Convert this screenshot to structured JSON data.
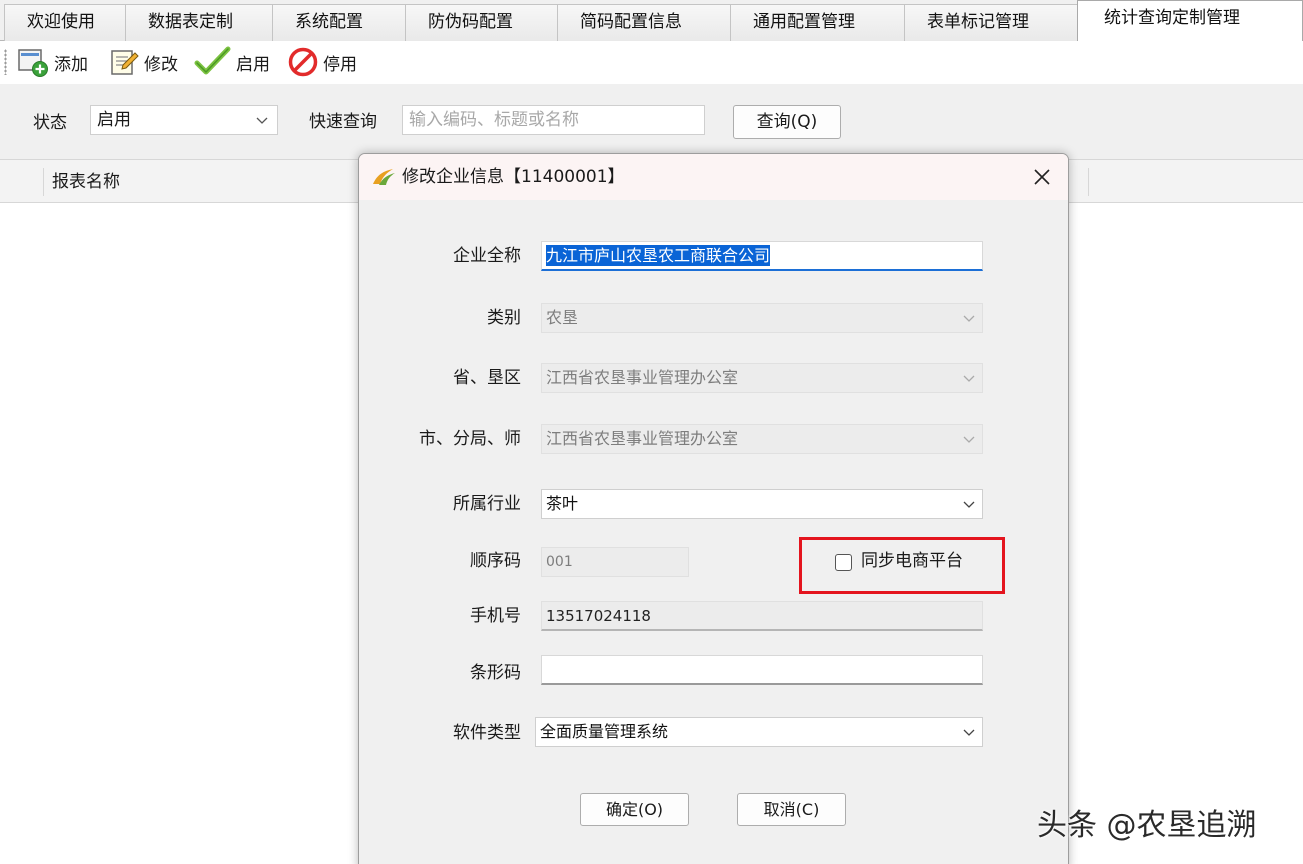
{
  "tabs": [
    {
      "label": "欢迎使用"
    },
    {
      "label": "数据表定制"
    },
    {
      "label": "系统配置"
    },
    {
      "label": "防伪码配置"
    },
    {
      "label": "简码配置信息"
    },
    {
      "label": "通用配置管理"
    },
    {
      "label": "表单标记管理"
    },
    {
      "label": "统计查询定制管理"
    }
  ],
  "toolbar": {
    "add_label": "添加",
    "edit_label": "修改",
    "enable_label": "启用",
    "disable_label": "停用"
  },
  "filter": {
    "status_label": "状态",
    "status_value": "启用",
    "quick_label": "快速查询",
    "quick_placeholder": "输入编码、标题或名称",
    "query_button": "查询(Q)"
  },
  "grid": {
    "columns": [
      "报表名称"
    ]
  },
  "dialog": {
    "title": "修改企业信息【11400001】",
    "fields": {
      "full_name_label": "企业全称",
      "full_name_value": "九江市庐山农垦农工商联合公司",
      "category_label": "类别",
      "category_value": "农垦",
      "province_label": "省、垦区",
      "province_value": "江西省农垦事业管理办公室",
      "city_label": "市、分局、师",
      "city_value": "江西省农垦事业管理办公室",
      "industry_label": "所属行业",
      "industry_value": "茶叶",
      "sequence_label": "顺序码",
      "sequence_value": "001",
      "sync_label": "同步电商平台",
      "sync_checked": false,
      "phone_label": "手机号",
      "phone_value": "13517024118",
      "barcode_label": "条形码",
      "barcode_value": "",
      "software_label": "软件类型",
      "software_value": "全面质量管理系统"
    },
    "ok_button": "确定(O)",
    "cancel_button": "取消(C)"
  },
  "watermark": "头条 @农垦追溯",
  "colors": {
    "highlight": "#e4141e",
    "selection": "#0a64d6"
  }
}
